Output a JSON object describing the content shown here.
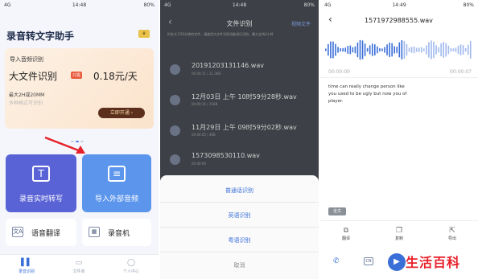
{
  "colors": {
    "accent": "#3b6fd8",
    "realtime_card": "#5a63d6",
    "import_card": "#5b95ec",
    "watermark": "#e8202a"
  },
  "phone1": {
    "status": {
      "signal": "4G",
      "time": "14:48",
      "battery": "80%"
    },
    "app_title": "录音转文字助手",
    "vip_icon": "crown-icon",
    "banner": {
      "heading": "导入音频识别",
      "main": "大文件识别",
      "tag": "只需",
      "price": "0.18元/天",
      "line1": "最大2H或20MM",
      "line2": "多种格式可识别",
      "button": "立即开通 ›"
    },
    "cards": {
      "realtime": {
        "icon": "T",
        "label": "录音实时转写"
      },
      "import": {
        "icon": "≡",
        "label": "导入外部音频"
      }
    },
    "mini": {
      "translate": {
        "icon": "文A",
        "label": "语音翻译"
      },
      "recorder": {
        "icon": "▦",
        "label": "录音机"
      }
    },
    "tabs": [
      {
        "icon": "▌▌",
        "label": "录音识别"
      },
      {
        "icon": "▭",
        "label": "文件库"
      },
      {
        "icon": "◯",
        "label": "个人中心"
      }
    ]
  },
  "phone2": {
    "status": {
      "signal": "4G",
      "time": "14:48",
      "battery": "80%"
    },
    "title": "文件识别",
    "action": "视频文件",
    "note": "时长大于20分钟的文件，请使用大文件识别功能进行识别，最大支持2小时",
    "records": [
      {
        "name": "20191203131146.wav",
        "meta": "00:00:11 | 11.3KB"
      },
      {
        "name": "12月03日 上午 10时59分28秒.wav",
        "meta": "00:00:16 | 15KB"
      },
      {
        "name": "11月29日 上午 09时59分02秒.wav",
        "meta": "00:00:05 | 4KB"
      },
      {
        "name": "1573098530110.wav",
        "meta": "00:00:09"
      }
    ],
    "sheet": {
      "opt1": "普通话识别",
      "opt2": "英语识别",
      "opt3": "粤语识别",
      "cancel": "取消"
    }
  },
  "phone3": {
    "status": {
      "signal": "4G",
      "time": "14:49",
      "battery": "80%"
    },
    "title": "1571972988555.wav",
    "time_start": "00:00:00",
    "time_end": "00:00:07",
    "transcript": "time can really change person like you used to be ugly but now you of player.",
    "translate_btn": "全文",
    "tools": [
      {
        "icon": "⧉",
        "label": "翻译"
      },
      {
        "icon": "❐",
        "label": "复制"
      },
      {
        "icon": "⇱",
        "label": "导出"
      }
    ],
    "bottom": {
      "phone_icon": "✆",
      "cn_icon": "CN",
      "play_icon": "▶"
    }
  },
  "watermark": "生活百科"
}
